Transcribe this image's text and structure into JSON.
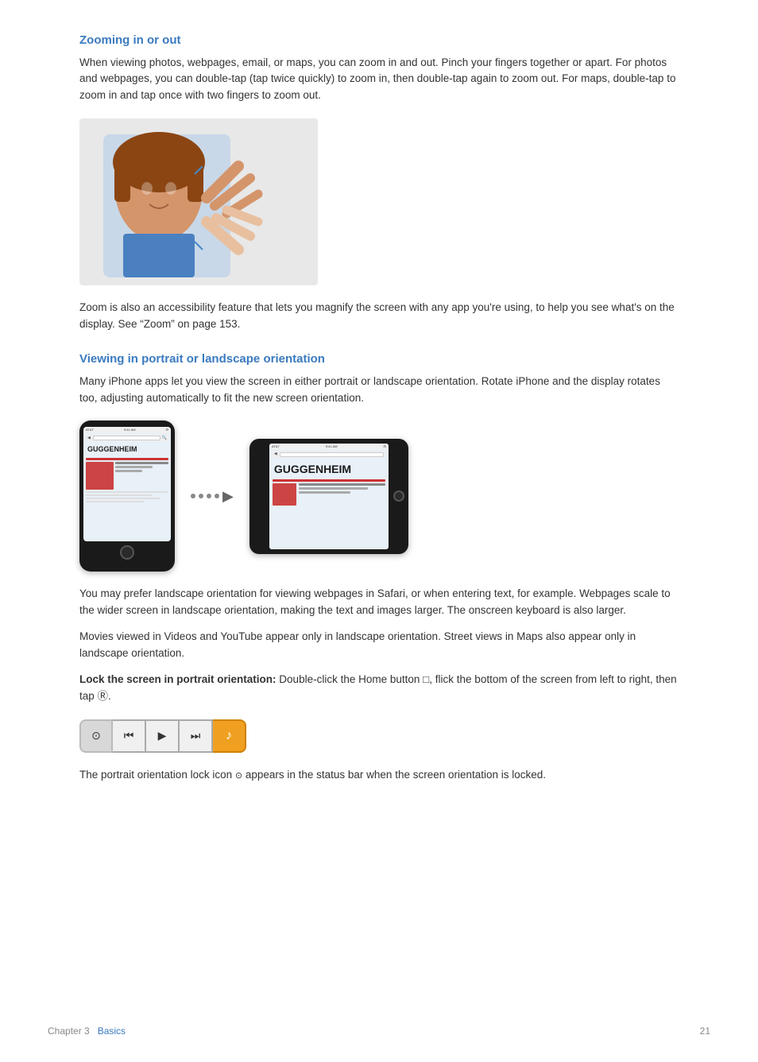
{
  "sections": {
    "zooming": {
      "title": "Zooming in or out",
      "body1": "When viewing photos, webpages, email, or maps, you can zoom in and out. Pinch your fingers together or apart. For photos and webpages, you can double-tap (tap twice quickly) to zoom in, then double-tap again to zoom out. For maps, double-tap to zoom in and tap once with two fingers to zoom out.",
      "body2": "Zoom is also an accessibility feature that lets you magnify the screen with any app you're using, to help you see what's on the display. See “Zoom” on page 153."
    },
    "orientation": {
      "title": "Viewing in portrait or landscape orientation",
      "body1": "Many iPhone apps let you view the screen in either portrait or landscape orientation. Rotate iPhone and the display rotates too, adjusting automatically to fit the new screen orientation.",
      "body2": "You may prefer landscape orientation for viewing webpages in Safari, or when entering text, for example. Webpages scale to the wider screen in landscape orientation, making the text and images larger. The onscreen keyboard is also larger.",
      "body3": "Movies viewed in Videos and YouTube appear only in landscape orientation. Street views in Maps also appear only in landscape orientation.",
      "lock_label": "Lock the screen in portrait orientation:",
      "lock_body": "  Double-click the Home button □, flick the bottom of the screen from left to right, then tap Ⓡ.",
      "lock_note": "The portrait orientation lock icon Ⓡ appears in the status bar when the screen orientation is locked."
    }
  },
  "footer": {
    "chapter": "Chapter 3",
    "section": "Basics",
    "page": "21"
  },
  "media_controls": {
    "lock_icon": "🔒",
    "prev_icon": "⏮",
    "play_icon": "▶",
    "next_icon": "⏭",
    "music_icon": "♪"
  }
}
